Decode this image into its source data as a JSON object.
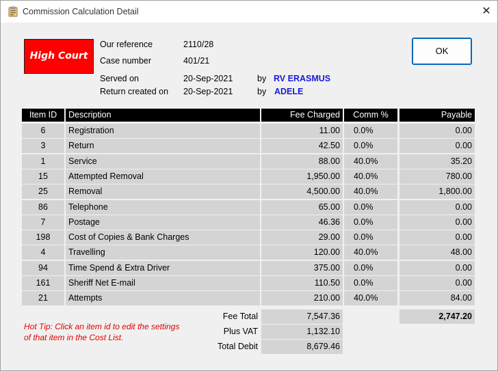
{
  "window": {
    "title": "Commission Calculation Detail",
    "close_glyph": "✕",
    "icon": "clipboard-icon"
  },
  "badge": {
    "label": "High Court",
    "color": "#ff0000"
  },
  "info": {
    "our_reference_label": "Our reference",
    "our_reference": "2110/28",
    "case_number_label": "Case number",
    "case_number": "401/21",
    "served_on_label": "Served on",
    "served_on": "20-Sep-2021",
    "served_by_label": "by",
    "served_by": "RV ERASMUS",
    "return_created_label": "Return created  on",
    "return_created": "20-Sep-2021",
    "return_by_label": "by",
    "return_by": "ADELE"
  },
  "ok_button": {
    "label": "OK"
  },
  "table": {
    "headers": {
      "item_id": "Item ID",
      "description": "Description",
      "fee": "Fee Charged",
      "comm": "Comm %",
      "payable": "Payable"
    },
    "rows": [
      {
        "id": "6",
        "desc": "Registration",
        "fee": "11.00",
        "comm": "0.0%",
        "pay": "0.00"
      },
      {
        "id": "3",
        "desc": "Return",
        "fee": "42.50",
        "comm": "0.0%",
        "pay": "0.00"
      },
      {
        "id": "1",
        "desc": "Service",
        "fee": "88.00",
        "comm": "40.0%",
        "pay": "35.20"
      },
      {
        "id": "15",
        "desc": "Attempted Removal",
        "fee": "1,950.00",
        "comm": "40.0%",
        "pay": "780.00"
      },
      {
        "id": "25",
        "desc": "Removal",
        "fee": "4,500.00",
        "comm": "40.0%",
        "pay": "1,800.00"
      },
      {
        "id": "86",
        "desc": "Telephone",
        "fee": "65.00",
        "comm": "0.0%",
        "pay": "0.00"
      },
      {
        "id": "7",
        "desc": "Postage",
        "fee": "46.36",
        "comm": "0.0%",
        "pay": "0.00"
      },
      {
        "id": "198",
        "desc": "Cost of Copies & Bank Charges",
        "fee": "29.00",
        "comm": "0.0%",
        "pay": "0.00"
      },
      {
        "id": "4",
        "desc": "Travelling",
        "fee": "120.00",
        "comm": "40.0%",
        "pay": "48.00"
      },
      {
        "id": "94",
        "desc": "Time Spend & Extra Driver",
        "fee": "375.00",
        "comm": "0.0%",
        "pay": "0.00"
      },
      {
        "id": "161",
        "desc": "Sheriff Net E-mail",
        "fee": "110.50",
        "comm": "0.0%",
        "pay": "0.00"
      },
      {
        "id": "21",
        "desc": "Attempts",
        "fee": "210.00",
        "comm": "40.0%",
        "pay": "84.00"
      }
    ]
  },
  "totals": {
    "fee_total_label": "Fee Total",
    "fee_total": "7,547.36",
    "vat_label": "Plus VAT",
    "vat": "1,132.10",
    "debit_label": "Total Debit",
    "debit": "8,679.46",
    "payable_total": "2,747.20"
  },
  "hot_tip": "Hot Tip: Click an item id to edit the settings of that item in the Cost List."
}
